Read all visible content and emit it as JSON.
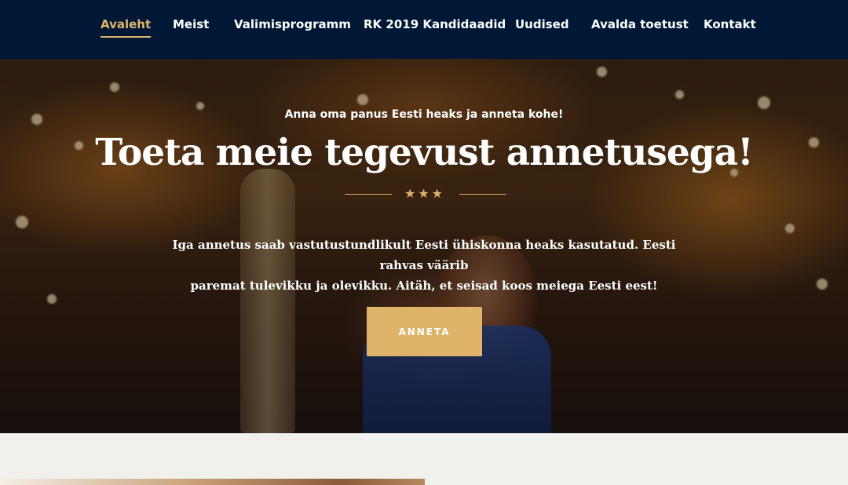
{
  "nav": {
    "items": [
      {
        "label": "Avaleht",
        "active": true
      },
      {
        "label": "Meist",
        "active": false
      },
      {
        "label": "Valimisprogramm",
        "active": false
      },
      {
        "label": "RK 2019 Kandidaadid",
        "active": false
      },
      {
        "label": "Uudised",
        "active": false
      },
      {
        "label": "Avalda toetust",
        "active": false
      },
      {
        "label": "Kontakt",
        "active": false
      }
    ]
  },
  "hero": {
    "subtitle": "Anna oma panus Eesti heaks ja anneta kohe!",
    "headline": "Toeta meie tegevust annetusega!",
    "stars": "★★★",
    "body_line1": "Iga annetus saab vastutustundlikult Eesti ühiskonna heaks kasutatud. Eesti rahvas väärib",
    "body_line2": "paremat tulevikku ja olevikku. Aitäh, et seisad koos meiega Eesti eest!",
    "cta_label": "ANNETA"
  },
  "colors": {
    "nav_background": "#001736",
    "accent_gold": "#dfb46a",
    "section_background": "#f0f0ec"
  }
}
